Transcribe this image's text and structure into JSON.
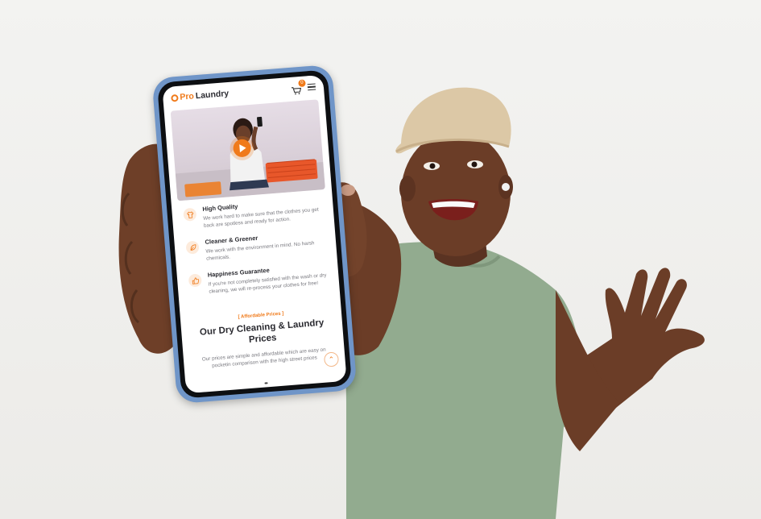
{
  "app": {
    "logo_pro": "Pro",
    "logo_laundry": "Laundry",
    "cart_count": "0"
  },
  "features": [
    {
      "title": "High Quality",
      "desc": "We work hard to make sure that the clothes you get back are spotless and ready for action."
    },
    {
      "title": "Cleaner & Greener",
      "desc": "We work with the environment in mind. No harsh chemicals."
    },
    {
      "title": "Happiness Guarantee",
      "desc": "If you're not completely satisfied with the wash or dry cleaning, we will re-process your clothes for free!"
    }
  ],
  "prices": {
    "eyebrow": "[ Affordable Prices ]",
    "title": "Our Dry Cleaning & Laundry Prices",
    "desc": "Our prices are simple and affordable which are easy on pocketin comparison with the high street prices"
  },
  "icons": [
    "cart-icon",
    "menu-icon",
    "play-icon",
    "shirt-icon",
    "leaf-icon",
    "thumbs-up-icon",
    "chevron-up-icon"
  ],
  "colors": {
    "accent": "#f07a1a",
    "phone_case": "#6f95c8",
    "shirt": "#8fa88c"
  }
}
